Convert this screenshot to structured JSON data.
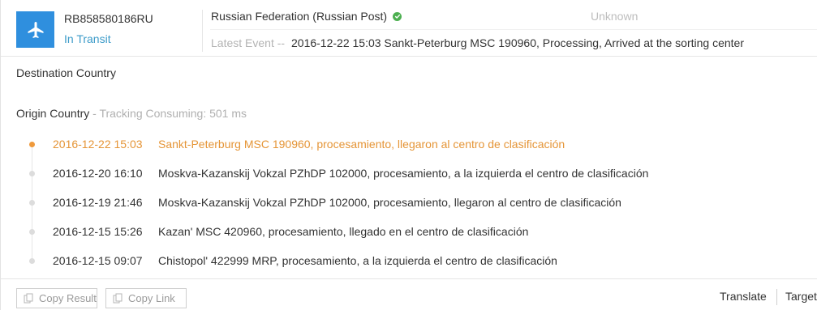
{
  "header": {
    "tracking_number": "RB858580186RU",
    "status": "In Transit",
    "carrier": "Russian Federation (Russian Post)",
    "carrier_check_icon": "verified-check-icon",
    "destination_carrier": "Unknown",
    "latest_event_label": "Latest Event --",
    "latest_event_text": "2016-12-22 15:03 Sankt-Peterburg MSC 190960, Processing, Arrived at the sorting center"
  },
  "destination_country_label": "Destination Country",
  "origin": {
    "label": "Origin Country",
    "consuming_text": " - Tracking Consuming: 501 ms"
  },
  "events": [
    {
      "time": "2016-12-22 15:03",
      "desc": "Sankt-Peterburg MSC 190960, procesamiento, llegaron al centro de clasificación",
      "active": true
    },
    {
      "time": "2016-12-20 16:10",
      "desc": "Moskva-Kazanskij Vokzal PZhDP 102000, procesamiento, a la izquierda el centro de clasificación",
      "active": false
    },
    {
      "time": "2016-12-19 21:46",
      "desc": "Moskva-Kazanskij Vokzal PZhDP 102000, procesamiento, llegaron al centro de clasificación",
      "active": false
    },
    {
      "time": "2016-12-15 15:26",
      "desc": "Kazan' MSC 420960, procesamiento, llegado en el centro de clasificación",
      "active": false
    },
    {
      "time": "2016-12-15 09:07",
      "desc": "Chistopol' 422999 MRP, procesamiento, a la izquierda el centro de clasificación",
      "active": false
    }
  ],
  "footer": {
    "copy_result_label": "Copy Result",
    "copy_link_label": "Copy Link",
    "translate_label": "Translate",
    "target_label": "Target"
  },
  "colors": {
    "accent_blue": "#2f8fde",
    "status_blue": "#3c9bc9",
    "active_orange": "#e59537",
    "check_green": "#4caf50"
  }
}
